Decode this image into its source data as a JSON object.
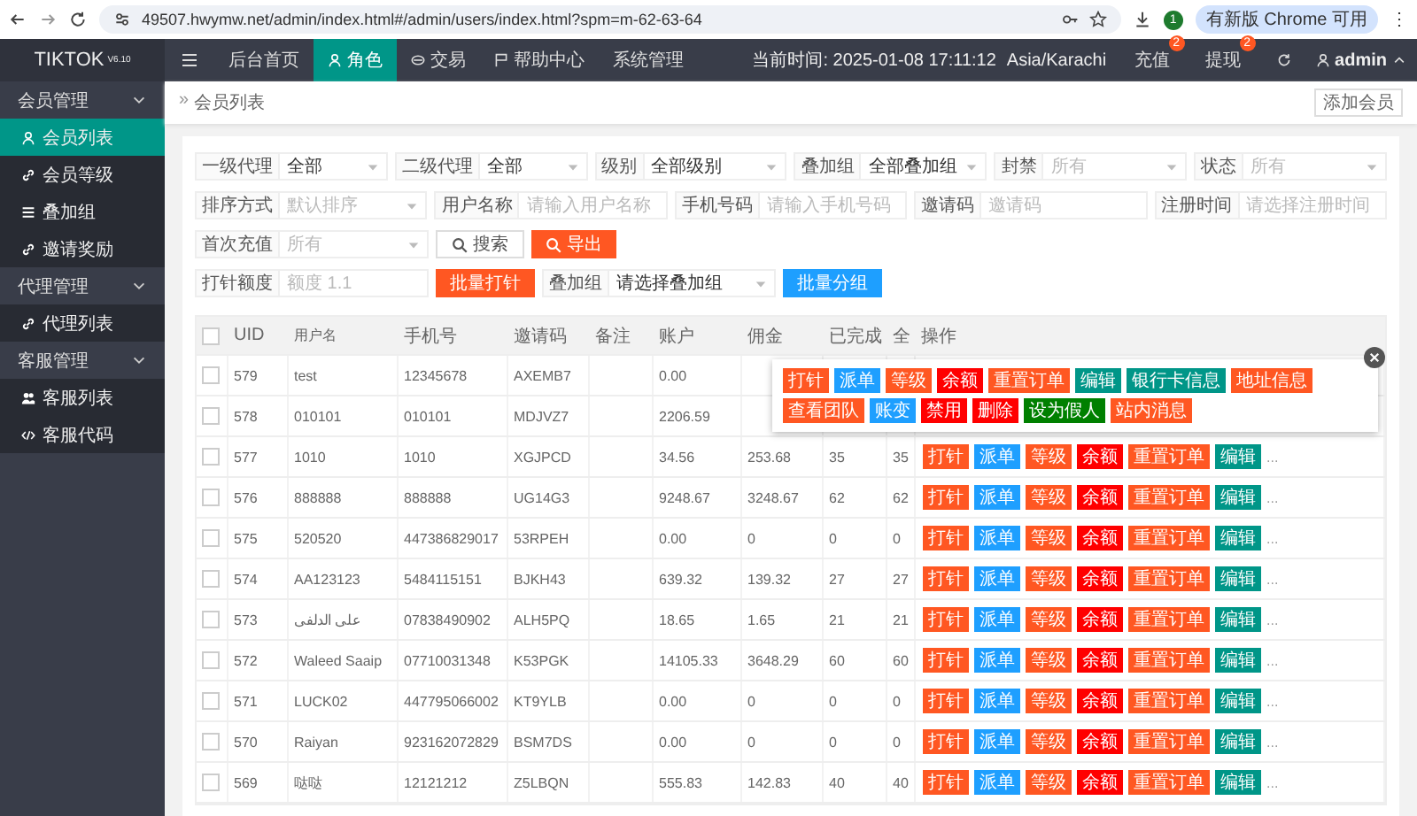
{
  "browser": {
    "url": "49507.hwymw.net/admin/index.html#/admin/users/index.html?spm=m-62-63-64",
    "profile": "1",
    "update_button": "有新版 Chrome 可用",
    "menu": "⋮"
  },
  "logo": {
    "name": "TIKTOK",
    "version": "V6.10"
  },
  "nav": [
    {
      "label": "后台首页",
      "selected": false
    },
    {
      "label": "角色",
      "selected": true
    },
    {
      "label": "交易",
      "selected": false
    },
    {
      "label": "帮助中心",
      "selected": false
    },
    {
      "label": "系统管理",
      "selected": false
    }
  ],
  "header_right": {
    "time": "当前时间: 2025-01-08 17:11:12",
    "timezone": "Asia/Karachi",
    "links": [
      {
        "label": "充值",
        "badge": "2"
      },
      {
        "label": "提现",
        "badge": "2"
      }
    ],
    "user": "admin"
  },
  "sidebar": [
    {
      "label": "会员管理",
      "expanded": true,
      "children": [
        {
          "label": "会员列表",
          "selected": true
        },
        {
          "label": "会员等级",
          "selected": false
        },
        {
          "label": "叠加组",
          "selected": false
        },
        {
          "label": "邀请奖励",
          "selected": false
        }
      ]
    },
    {
      "label": "代理管理",
      "expanded": true,
      "children": [
        {
          "label": "代理列表",
          "selected": false
        }
      ]
    },
    {
      "label": "客服管理",
      "expanded": true,
      "children": [
        {
          "label": "客服列表",
          "selected": false
        },
        {
          "label": "客服代码",
          "selected": false
        }
      ]
    }
  ],
  "breadcrumb_separator": "»",
  "breadcrumb": "会员列表",
  "add_button": "添加会员",
  "filters": [
    [
      {
        "kind": "select",
        "label": "一级代理",
        "value": "全部"
      },
      {
        "kind": "select",
        "label": "二级代理",
        "value": "全部"
      },
      {
        "kind": "select",
        "label": "级别",
        "value": "全部级别"
      },
      {
        "kind": "select",
        "label": "叠加组",
        "value": "全部叠加组"
      },
      {
        "kind": "select",
        "label": "封禁",
        "placeholder": "所有"
      },
      {
        "kind": "select",
        "label": "状态",
        "placeholder": "所有"
      }
    ],
    [
      {
        "kind": "select",
        "label": "排序方式",
        "placeholder": "默认排序"
      },
      {
        "kind": "input",
        "label": "用户名称",
        "placeholder": "请输入用户名称"
      },
      {
        "kind": "input",
        "label": "手机号码",
        "placeholder": "请输入手机号码"
      },
      {
        "kind": "input",
        "label": "邀请码",
        "placeholder": "邀请码"
      },
      {
        "kind": "input",
        "label": "注册时间",
        "placeholder": "请选择注册时间"
      }
    ],
    [
      {
        "kind": "select",
        "label": "首次充值",
        "placeholder": "所有"
      },
      {
        "kind": "icon_button",
        "label": "搜索",
        "color": "#ffffff"
      },
      {
        "kind": "icon_button",
        "label": "导出",
        "color": "#ff5722"
      }
    ],
    [
      {
        "kind": "input",
        "label": "打针额度",
        "placeholder": "额度 1.1"
      },
      {
        "kind": "button",
        "label": "批量打针",
        "color": "#ff5722"
      },
      {
        "kind": "select",
        "label": "叠加组",
        "value": "请选择叠加组"
      },
      {
        "kind": "button",
        "label": "批量分组",
        "color": "#1e9fff"
      }
    ]
  ],
  "table": {
    "select_all_checked": false,
    "columns": [
      "UID",
      "用户名",
      "手机号",
      "邀请码",
      "备注",
      "账户",
      "佣金",
      "已完成",
      "全",
      "操作"
    ],
    "rows": [
      {
        "checked": false,
        "uid": "579",
        "username": "test",
        "phone": "12345678",
        "invite": "AXEMB7",
        "account": "0.00"
      },
      {
        "checked": false,
        "uid": "578",
        "username": "010101",
        "phone": "010101",
        "invite": "MDJVZ7",
        "account": "2206.59"
      },
      {
        "checked": false,
        "uid": "577",
        "username": "1010",
        "phone": "1010",
        "invite": "XGJPCD",
        "account": "34.56",
        "commission": "253.68",
        "completed": "35",
        "column_10": "35",
        "actions": [
          {
            "label": "打针",
            "color": "#ff5722"
          },
          {
            "label": "派单",
            "color": "#1e9fff"
          },
          {
            "label": "等级",
            "color": "#ff5722"
          },
          {
            "label": "余额",
            "color": "#ff0000"
          },
          {
            "label": "重置订单",
            "color": "#ff5722"
          },
          {
            "label": "编辑",
            "color": "#009688"
          }
        ],
        "more": "..."
      },
      {
        "checked": false,
        "uid": "576",
        "username": "888888",
        "phone": "888888",
        "invite": "UG14G3",
        "account": "9248.67",
        "commission": "3248.67",
        "completed": "62",
        "column_10": "62",
        "actions": [
          {
            "label": "打针",
            "color": "#ff5722"
          },
          {
            "label": "派单",
            "color": "#1e9fff"
          },
          {
            "label": "等级",
            "color": "#ff5722"
          },
          {
            "label": "余额",
            "color": "#ff0000"
          },
          {
            "label": "重置订单",
            "color": "#ff5722"
          },
          {
            "label": "编辑",
            "color": "#009688"
          }
        ],
        "more": "..."
      },
      {
        "checked": false,
        "uid": "575",
        "username": "520520",
        "phone": "447386829017",
        "invite": "53RPEH",
        "account": "0.00",
        "commission": "0",
        "completed": "0",
        "column_10": "0",
        "actions": [
          {
            "label": "打针",
            "color": "#ff5722"
          },
          {
            "label": "派单",
            "color": "#1e9fff"
          },
          {
            "label": "等级",
            "color": "#ff5722"
          },
          {
            "label": "余额",
            "color": "#ff0000"
          },
          {
            "label": "重置订单",
            "color": "#ff5722"
          },
          {
            "label": "编辑",
            "color": "#009688"
          }
        ],
        "more": "..."
      },
      {
        "checked": false,
        "uid": "574",
        "username": "AA123123",
        "phone": "5484115151",
        "invite": "BJKH43",
        "account": "639.32",
        "commission": "139.32",
        "completed": "27",
        "column_10": "27",
        "actions": [
          {
            "label": "打针",
            "color": "#ff5722"
          },
          {
            "label": "派单",
            "color": "#1e9fff"
          },
          {
            "label": "等级",
            "color": "#ff5722"
          },
          {
            "label": "余额",
            "color": "#ff0000"
          },
          {
            "label": "重置订单",
            "color": "#ff5722"
          },
          {
            "label": "编辑",
            "color": "#009688"
          }
        ],
        "more": "..."
      },
      {
        "checked": false,
        "uid": "573",
        "username": "علی الدلفی",
        "phone": "07838490902",
        "invite": "ALH5PQ",
        "account": "18.65",
        "commission": "1.65",
        "completed": "21",
        "column_10": "21",
        "actions": [
          {
            "label": "打针",
            "color": "#ff5722"
          },
          {
            "label": "派单",
            "color": "#1e9fff"
          },
          {
            "label": "等级",
            "color": "#ff5722"
          },
          {
            "label": "余额",
            "color": "#ff0000"
          },
          {
            "label": "重置订单",
            "color": "#ff5722"
          },
          {
            "label": "编辑",
            "color": "#009688"
          }
        ],
        "more": "..."
      },
      {
        "checked": false,
        "uid": "572",
        "username": "Waleed Saaip",
        "phone": "07710031348",
        "invite": "K53PGK",
        "account": "14105.33",
        "commission": "3648.29",
        "completed": "60",
        "column_10": "60",
        "actions": [
          {
            "label": "打针",
            "color": "#ff5722"
          },
          {
            "label": "派单",
            "color": "#1e9fff"
          },
          {
            "label": "等级",
            "color": "#ff5722"
          },
          {
            "label": "余额",
            "color": "#ff0000"
          },
          {
            "label": "重置订单",
            "color": "#ff5722"
          },
          {
            "label": "编辑",
            "color": "#009688"
          }
        ],
        "more": "..."
      },
      {
        "checked": false,
        "uid": "571",
        "username": "LUCK02",
        "phone": "447795066002",
        "invite": "KT9YLB",
        "account": "0.00",
        "commission": "0",
        "completed": "0",
        "column_10": "0",
        "actions": [
          {
            "label": "打针",
            "color": "#ff5722"
          },
          {
            "label": "派单",
            "color": "#1e9fff"
          },
          {
            "label": "等级",
            "color": "#ff5722"
          },
          {
            "label": "余额",
            "color": "#ff0000"
          },
          {
            "label": "重置订单",
            "color": "#ff5722"
          },
          {
            "label": "编辑",
            "color": "#009688"
          }
        ],
        "more": "..."
      },
      {
        "checked": false,
        "uid": "570",
        "username": "Raiyan",
        "phone": "923162072829",
        "invite": "BSM7DS",
        "account": "0.00",
        "commission": "0",
        "completed": "0",
        "column_10": "0",
        "actions": [
          {
            "label": "打针",
            "color": "#ff5722"
          },
          {
            "label": "派单",
            "color": "#1e9fff"
          },
          {
            "label": "等级",
            "color": "#ff5722"
          },
          {
            "label": "余额",
            "color": "#ff0000"
          },
          {
            "label": "重置订单",
            "color": "#ff5722"
          },
          {
            "label": "编辑",
            "color": "#009688"
          }
        ],
        "more": "..."
      },
      {
        "checked": false,
        "uid": "569",
        "username": "哒哒",
        "phone": "12121212",
        "invite": "Z5LBQN",
        "account": "555.83",
        "commission": "142.83",
        "completed": "40",
        "column_10": "40",
        "actions": [
          {
            "label": "打针",
            "color": "#ff5722"
          },
          {
            "label": "派单",
            "color": "#1e9fff"
          },
          {
            "label": "等级",
            "color": "#ff5722"
          },
          {
            "label": "余额",
            "color": "#ff0000"
          },
          {
            "label": "重置订单",
            "color": "#ff5722"
          },
          {
            "label": "编辑",
            "color": "#009688"
          }
        ],
        "more": "..."
      }
    ]
  },
  "action_popup": {
    "actions": [
      {
        "label": "打针",
        "color": "#ff5722"
      },
      {
        "label": "派单",
        "color": "#1e9fff"
      },
      {
        "label": "等级",
        "color": "#ff5722"
      },
      {
        "label": "余额",
        "color": "#ff0000"
      },
      {
        "label": "重置订单",
        "color": "#ff5722"
      },
      {
        "label": "编辑",
        "color": "#009688"
      },
      {
        "label": "银行卡信息",
        "color": "#009688"
      },
      {
        "label": "地址信息",
        "color": "#ff5722"
      },
      {
        "label": "查看团队",
        "color": "#ff5722"
      },
      {
        "label": "账变",
        "color": "#1e9fff"
      },
      {
        "label": "禁用",
        "color": "#ff0000"
      },
      {
        "label": "删除",
        "color": "#ff0000"
      },
      {
        "label": "设为假人",
        "color": "#008000"
      },
      {
        "label": "站内消息",
        "color": "#ff5722"
      }
    ]
  }
}
